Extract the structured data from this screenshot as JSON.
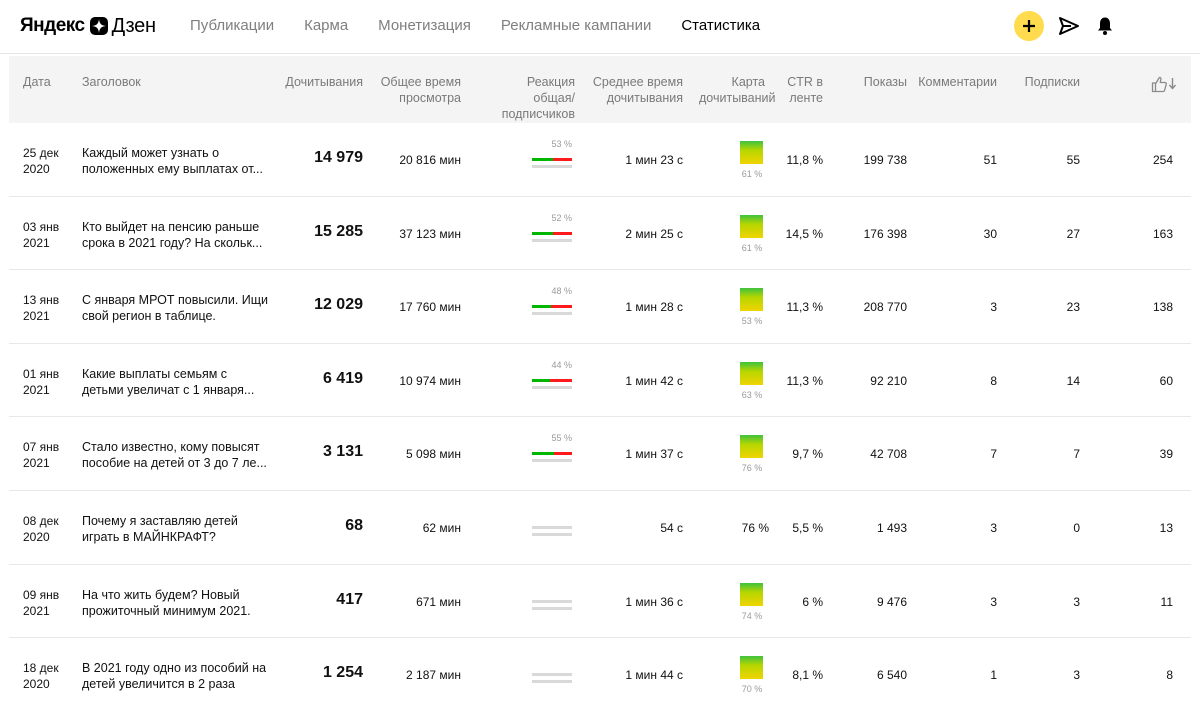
{
  "header": {
    "logo_yandex": "Яндекс",
    "logo_dzen": "Дзен",
    "nav": [
      {
        "label": "Публикации",
        "active": false
      },
      {
        "label": "Карма",
        "active": false
      },
      {
        "label": "Монетизация",
        "active": false
      },
      {
        "label": "Рекламные кампании",
        "active": false
      },
      {
        "label": "Статистика",
        "active": true
      }
    ],
    "icons": [
      "plus-icon",
      "paper-plane-icon",
      "bell-icon"
    ],
    "accent_color": "#ffdb4d"
  },
  "table": {
    "columns": {
      "date": "Дата",
      "title": "Заголовок",
      "reads": "Дочитывания",
      "total_time": "Общее время просмотра",
      "reaction": "Реакция общая/ подписчиков",
      "avg_time": "Среднее время дочитывания",
      "read_map": "Карта дочитываний",
      "ctr": "CTR в ленте",
      "shows": "Показы",
      "comments": "Комментарии",
      "subs": "Подписки",
      "likes_icon": "thumbs-up-sort-icon"
    },
    "rows": [
      {
        "date": "25 дек 2020",
        "title": "Каждый может узнать о положенных ему выплатах от...",
        "reads": "14 979",
        "total_time": "20 816 мин",
        "reaction_pct": "53 %",
        "reaction": 0.53,
        "avg_time": "1 мин 23 с",
        "map_pct": "61 %",
        "map_visual": true,
        "ctr": "11,8 %",
        "shows": "199 738",
        "comments": "51",
        "subs": "55",
        "likes": "254"
      },
      {
        "date": "03 янв 2021",
        "title": "Кто выйдет на пенсию раньше срока в 2021 году? На скольк...",
        "reads": "15 285",
        "total_time": "37 123 мин",
        "reaction_pct": "52 %",
        "reaction": 0.52,
        "avg_time": "2 мин 25 с",
        "map_pct": "61 %",
        "map_visual": true,
        "ctr": "14,5 %",
        "shows": "176 398",
        "comments": "30",
        "subs": "27",
        "likes": "163"
      },
      {
        "date": "13 янв 2021",
        "title": "С января МРОТ повысили. Ищи свой регион в таблице.",
        "reads": "12 029",
        "total_time": "17 760 мин",
        "reaction_pct": "48 %",
        "reaction": 0.48,
        "avg_time": "1 мин 28 с",
        "map_pct": "53 %",
        "map_visual": true,
        "ctr": "11,3 %",
        "shows": "208 770",
        "comments": "3",
        "subs": "23",
        "likes": "138"
      },
      {
        "date": "01 янв 2021",
        "title": "Какие выплаты семьям с детьми увеличат с 1 января...",
        "reads": "6 419",
        "total_time": "10 974 мин",
        "reaction_pct": "44 %",
        "reaction": 0.44,
        "avg_time": "1 мин 42 с",
        "map_pct": "63 %",
        "map_visual": true,
        "ctr": "11,3 %",
        "shows": "92 210",
        "comments": "8",
        "subs": "14",
        "likes": "60"
      },
      {
        "date": "07 янв 2021",
        "title": "Стало известно, кому повысят пособие на детей от 3 до 7 ле...",
        "reads": "3 131",
        "total_time": "5 098 мин",
        "reaction_pct": "55 %",
        "reaction": 0.55,
        "avg_time": "1 мин 37 с",
        "map_pct": "76 %",
        "map_visual": true,
        "ctr": "9,7 %",
        "shows": "42 708",
        "comments": "7",
        "subs": "7",
        "likes": "39"
      },
      {
        "date": "08 дек 2020",
        "title": "Почему я заставляю детей играть в МАЙНКРАФТ?",
        "reads": "68",
        "total_time": "62 мин",
        "reaction_pct": "",
        "reaction": null,
        "avg_time": "54 с",
        "map_pct": "76 %",
        "map_visual": false,
        "ctr": "5,5 %",
        "shows": "1 493",
        "comments": "3",
        "subs": "0",
        "likes": "13"
      },
      {
        "date": "09 янв 2021",
        "title": "На что жить будем? Новый прожиточный минимум 2021.",
        "reads": "417",
        "total_time": "671 мин",
        "reaction_pct": "",
        "reaction": null,
        "avg_time": "1 мин 36 с",
        "map_pct": "74 %",
        "map_visual": true,
        "ctr": "6 %",
        "shows": "9 476",
        "comments": "3",
        "subs": "3",
        "likes": "11"
      },
      {
        "date": "18 дек 2020",
        "title": "В 2021 году одно из пособий на детей увеличится в 2 раза",
        "reads": "1 254",
        "total_time": "2 187 мин",
        "reaction_pct": "",
        "reaction": null,
        "avg_time": "1 мин 44 с",
        "map_pct": "70 %",
        "map_visual": true,
        "ctr": "8,1 %",
        "shows": "6 540",
        "comments": "1",
        "subs": "3",
        "likes": "8"
      }
    ]
  }
}
